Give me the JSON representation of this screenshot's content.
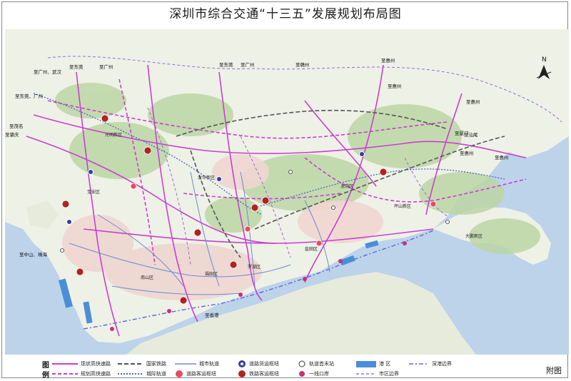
{
  "title": "深圳市综合交通“十三五”发展规划布局图",
  "north": "N",
  "figure_tag": "附图",
  "colors": {
    "sea": "#bcd3ea",
    "land": "#eef1e6",
    "green": "#bcd6a5",
    "urban": "#efd6d0",
    "expressway_existing": "#c93fd0",
    "expressway_planned": "#c93fd0",
    "national_rail": "#555555",
    "intercity_rail": "#4a66c4",
    "metro": "#6a8bd0",
    "hub_rail": "#b0231f",
    "port": "#4a8ed8",
    "boundary": "#6b6bd8"
  },
  "legend": {
    "head1": "图",
    "head2": "例",
    "items": [
      {
        "key": "existing_expressway",
        "label": "现状高快速路"
      },
      {
        "key": "planned_expressway",
        "label": "规划高快速路"
      },
      {
        "key": "national_rail",
        "label": "国家铁路"
      },
      {
        "key": "intercity_rail",
        "label": "城际轨道"
      },
      {
        "key": "metro",
        "label": "城市轨道"
      },
      {
        "key": "road_passenger_hub",
        "label": "道路客运枢纽"
      },
      {
        "key": "road_freight_hub",
        "label": "道路货运枢纽"
      },
      {
        "key": "rail_passenger_hub",
        "label": "铁路客运枢纽"
      },
      {
        "key": "rail_terminal",
        "label": "轨道首末站"
      },
      {
        "key": "first_line_port",
        "label": "一线口岸"
      },
      {
        "key": "harbor_area",
        "label": "港 区"
      },
      {
        "key": "district_boundary",
        "label": "市区边界"
      },
      {
        "key": "sz_hk_boundary",
        "label": "深港边界"
      }
    ]
  },
  "direction_labels": [
    "至东莞",
    "至广州、武汉",
    "至东莞、广州",
    "至广州",
    "至茂名",
    "至肇庆",
    "至东莞",
    "至广州",
    "至赣州",
    "至惠州",
    "至惠州",
    "至惠州",
    "至汕尾",
    "至厦门",
    "至惠州",
    "至惠州",
    "至中山、珠海",
    "至香港"
  ],
  "map_labels": [
    "大鹏新区",
    "坪山新区",
    "龙岗区",
    "宝安区",
    "南山区",
    "福田区",
    "罗湖区",
    "盐田区",
    "龙华新区",
    "光明新区"
  ]
}
